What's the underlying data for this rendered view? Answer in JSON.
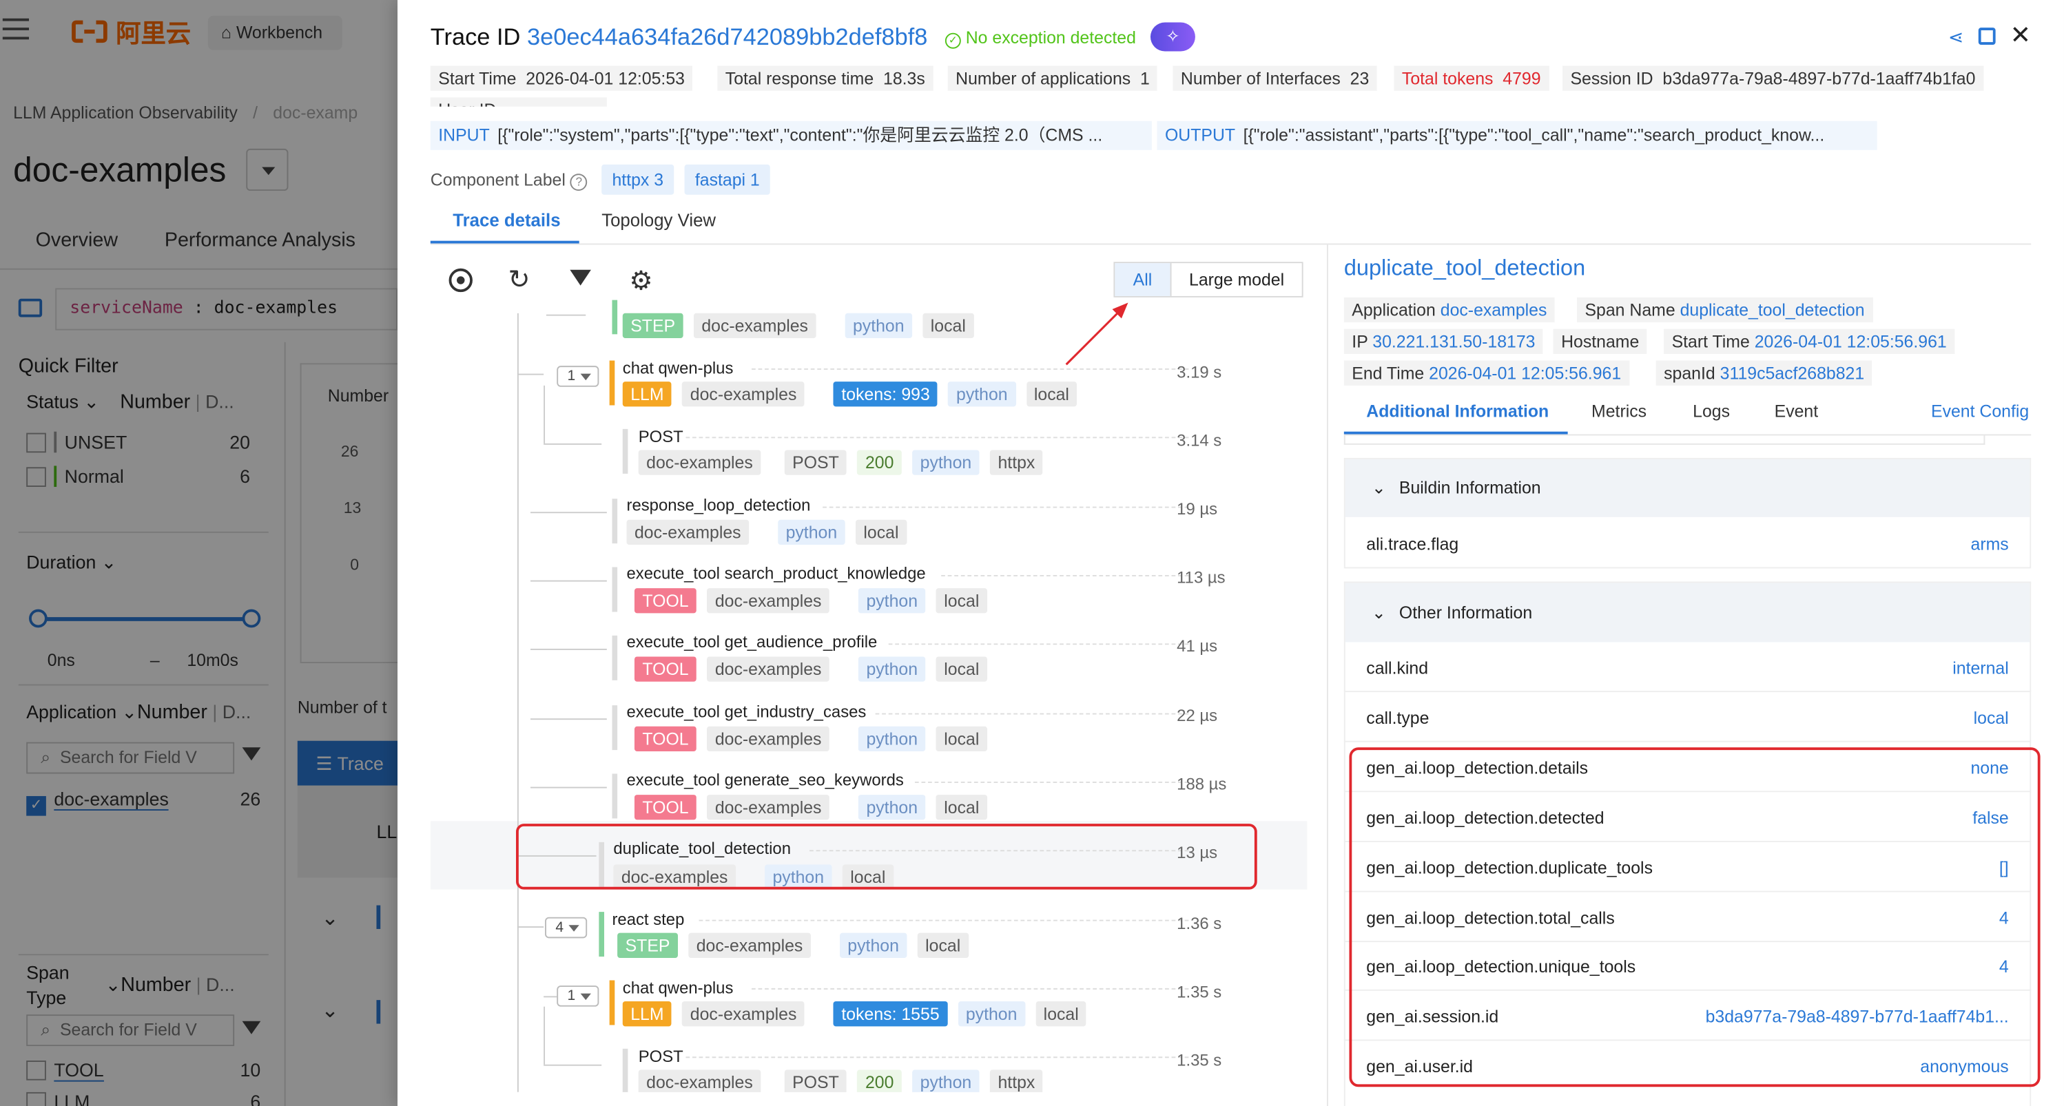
{
  "colors": {
    "brand_orange": "#ff6a00",
    "link_blue": "#2a78d6",
    "alert_red": "#e0282e",
    "success_green": "#52c41a",
    "step": "#84d29c",
    "llm": "#f5a623",
    "tool": "#f47a8f",
    "tokens": "#2f8bde"
  },
  "background": {
    "brand": "阿里云",
    "workbench": "Workbench",
    "breadcrumb_root": "LLM Application Observability",
    "breadcrumb_sep": "/",
    "breadcrumb_current": "doc-examp",
    "app_title": "doc-examples",
    "tabs": [
      "Overview",
      "Performance Analysis"
    ],
    "query_key": "serviceName",
    "query_sep": ":",
    "query_value": "doc-examples",
    "quick_filter": "Quick Filter",
    "status_label": "Status",
    "number_label": "Number",
    "d_label": "D...",
    "status_items": [
      {
        "label": "UNSET",
        "count": "20"
      },
      {
        "label": "Normal",
        "count": "6"
      }
    ],
    "duration_label": "Duration",
    "duration_min": "0ns",
    "duration_dash": "–",
    "duration_max": "10m0s",
    "application_label": "Application",
    "search_placeholder": "Search for Field V",
    "application_items": [
      {
        "label": "doc-examples",
        "count": "26"
      }
    ],
    "span_type_label": "Span Type",
    "span_type_items": [
      {
        "label": "TOOL",
        "count": "10"
      },
      {
        "label": "LLM",
        "count": "6"
      }
    ],
    "chart_label": "Number",
    "chart_ticks": [
      "26",
      "13",
      "0"
    ],
    "number_of": "Number of t",
    "trace_button": "Trace",
    "ll": "LL"
  },
  "drawer": {
    "title_label": "Trace ID",
    "trace_id": "3e0ec44a634fa26d742089bb2def8bf8",
    "exception_text": "No exception detected",
    "meta": [
      {
        "label": "Start Time",
        "value": "2026-04-01 12:05:53"
      },
      {
        "label": "Total response time",
        "value": "18.3s"
      },
      {
        "label": "Number of applications",
        "value": "1"
      },
      {
        "label": "Number of Interfaces",
        "value": "23"
      },
      {
        "label": "Total tokens",
        "value": "4799"
      },
      {
        "label": "Session ID",
        "value": "b3da977a-79a8-4897-b77d-1aaff74b1fa0"
      }
    ],
    "user_id_label": "User ID",
    "input_label": "INPUT",
    "input_value": "[{\"role\":\"system\",\"parts\":[{\"type\":\"text\",\"content\":\"你是阿里云云监控 2.0（CMS ...",
    "output_label": "OUTPUT",
    "output_value": "[{\"role\":\"assistant\",\"parts\":[{\"type\":\"tool_call\",\"name\":\"search_product_know...",
    "component_label": "Component Label",
    "components": [
      "httpx 3",
      "fastapi 1"
    ],
    "tabs": [
      "Trace details",
      "Topology View"
    ],
    "filter_all": "All",
    "filter_large": "Large model",
    "spans": [
      {
        "name": "",
        "dur": "",
        "tags": [
          "STEP",
          "doc-examples",
          "python",
          "local"
        ]
      },
      {
        "count": "1",
        "name": "chat qwen-plus",
        "dur": "3.19 s",
        "tags": [
          "LLM",
          "doc-examples",
          "tokens: 993",
          "python",
          "local"
        ]
      },
      {
        "name": "POST",
        "dur": "3.14 s",
        "tags": [
          "doc-examples",
          "POST",
          "200",
          "python",
          "httpx"
        ]
      },
      {
        "name": "response_loop_detection",
        "dur": "19 µs",
        "tags": [
          "doc-examples",
          "python",
          "local"
        ]
      },
      {
        "name": "execute_tool search_product_knowledge",
        "dur": "113 µs",
        "tags": [
          "TOOL",
          "doc-examples",
          "python",
          "local"
        ]
      },
      {
        "name": "execute_tool get_audience_profile",
        "dur": "41 µs",
        "tags": [
          "TOOL",
          "doc-examples",
          "python",
          "local"
        ]
      },
      {
        "name": "execute_tool get_industry_cases",
        "dur": "22 µs",
        "tags": [
          "TOOL",
          "doc-examples",
          "python",
          "local"
        ]
      },
      {
        "name": "execute_tool generate_seo_keywords",
        "dur": "188 µs",
        "tags": [
          "TOOL",
          "doc-examples",
          "python",
          "local"
        ]
      },
      {
        "name": "duplicate_tool_detection",
        "dur": "13 µs",
        "tags": [
          "doc-examples",
          "python",
          "local"
        ]
      },
      {
        "count": "4",
        "name": "react step",
        "dur": "1.36 s",
        "tags": [
          "STEP",
          "doc-examples",
          "python",
          "local"
        ]
      },
      {
        "count": "1",
        "name": "chat qwen-plus",
        "dur": "1.35 s",
        "tags": [
          "LLM",
          "doc-examples",
          "tokens: 1555",
          "python",
          "local"
        ]
      },
      {
        "name": "POST",
        "dur": "1.35 s",
        "tags": [
          "doc-examples",
          "POST",
          "200",
          "python",
          "httpx"
        ]
      }
    ],
    "detail": {
      "title": "duplicate_tool_detection",
      "info": [
        {
          "label": "Application",
          "value": "doc-examples"
        },
        {
          "label": "Span Name",
          "value": "duplicate_tool_detection"
        },
        {
          "label": "IP",
          "value": "30.221.131.50-18173"
        },
        {
          "label": "Hostname",
          "value": ""
        },
        {
          "label": "Start Time",
          "value": "2026-04-01 12:05:56.961"
        },
        {
          "label": "End Time",
          "value": "2026-04-01 12:05:56.961"
        },
        {
          "label": "spanId",
          "value": "3119c5acf268b821"
        }
      ],
      "tabs": [
        "Additional Information",
        "Metrics",
        "Logs",
        "Event"
      ],
      "event_config": "Event Config",
      "buildin_title": "Buildin Information",
      "buildin": [
        {
          "key": "ali.trace.flag",
          "value": "arms"
        }
      ],
      "other_title": "Other Information",
      "other": [
        {
          "key": "call.kind",
          "value": "internal"
        },
        {
          "key": "call.type",
          "value": "local"
        },
        {
          "key": "gen_ai.loop_detection.details",
          "value": "none"
        },
        {
          "key": "gen_ai.loop_detection.detected",
          "value": "false"
        },
        {
          "key": "gen_ai.loop_detection.duplicate_tools",
          "value": "[]"
        },
        {
          "key": "gen_ai.loop_detection.total_calls",
          "value": "4"
        },
        {
          "key": "gen_ai.loop_detection.unique_tools",
          "value": "4"
        },
        {
          "key": "gen_ai.session.id",
          "value": "b3da977a-79a8-4897-b77d-1aaff74b1..."
        },
        {
          "key": "gen_ai.user.id",
          "value": "anonymous"
        }
      ]
    }
  }
}
